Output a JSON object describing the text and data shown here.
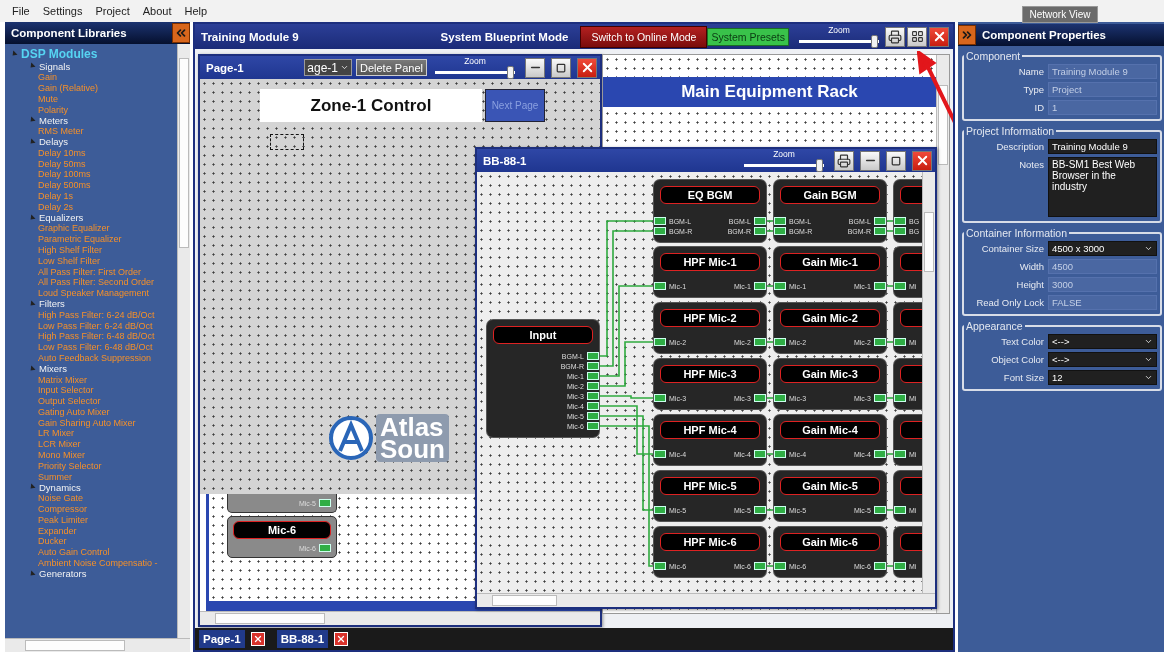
{
  "menu": [
    "File",
    "Settings",
    "Project",
    "About",
    "Help"
  ],
  "network_view_button": "Network View",
  "libraries": {
    "title": "Component Libraries",
    "tree": [
      {
        "label": "DSP Modules",
        "expanded": true,
        "children": [
          {
            "label": "Signals",
            "expanded": true,
            "children": [
              {
                "label": "Gain"
              },
              {
                "label": "Gain (Relative)"
              },
              {
                "label": "Mute"
              },
              {
                "label": "Polarity"
              }
            ]
          },
          {
            "label": "Meters",
            "expanded": true,
            "children": [
              {
                "label": "RMS Meter"
              }
            ]
          },
          {
            "label": "Delays",
            "expanded": true,
            "children": [
              {
                "label": "Delay 10ms"
              },
              {
                "label": "Delay 50ms"
              },
              {
                "label": "Delay 100ms"
              },
              {
                "label": "Delay 500ms"
              },
              {
                "label": "Delay 1s"
              },
              {
                "label": "Delay 2s"
              }
            ]
          },
          {
            "label": "Equalizers",
            "expanded": true,
            "children": [
              {
                "label": "Graphic Equalizer"
              },
              {
                "label": "Parametric Equalizer"
              },
              {
                "label": "High Shelf Filter"
              },
              {
                "label": "Low Shelf Filter"
              },
              {
                "label": "All Pass Filter: First Order"
              },
              {
                "label": "All Pass Filter: Second Order"
              },
              {
                "label": "Loud Speaker Management"
              }
            ]
          },
          {
            "label": "Filters",
            "expanded": true,
            "children": [
              {
                "label": "High Pass Filter: 6-24 dB/Oct"
              },
              {
                "label": "Low Pass Filter: 6-24 dB/Oct"
              },
              {
                "label": "High Pass Filter: 6-48 dB/Oct"
              },
              {
                "label": "Low Pass Filter: 6-48 dB/Oct"
              },
              {
                "label": "Auto Feedback Suppression"
              }
            ]
          },
          {
            "label": "Mixers",
            "expanded": true,
            "children": [
              {
                "label": "Matrix Mixer"
              },
              {
                "label": "Input Selector"
              },
              {
                "label": "Output Selector"
              },
              {
                "label": "Gating Auto Mixer"
              },
              {
                "label": "Gain Sharing Auto Mixer"
              },
              {
                "label": "LR Mixer"
              },
              {
                "label": "LCR Mixer"
              },
              {
                "label": "Mono Mixer"
              },
              {
                "label": "Priority Selector"
              },
              {
                "label": "Summer"
              }
            ]
          },
          {
            "label": "Dynamics",
            "expanded": true,
            "children": [
              {
                "label": "Noise Gate"
              },
              {
                "label": "Compressor"
              },
              {
                "label": "Peak Limiter"
              },
              {
                "label": "Expander"
              },
              {
                "label": "Ducker"
              },
              {
                "label": "Auto Gain Control"
              },
              {
                "label": "Ambient Noise Compensatio -"
              }
            ]
          },
          {
            "label": "Generators",
            "expanded": true
          }
        ]
      }
    ]
  },
  "workspace": {
    "title": "Training Module 9",
    "mode": "System Blueprint Mode",
    "online_button": "Switch to Online Mode",
    "presets_button": "System Presets",
    "zoom": {
      "label": "Zoom",
      "level": 0.95
    }
  },
  "page_window": {
    "title": "Page-1",
    "page_select": "age-1",
    "delete_button": "Delete Panel",
    "zoom": {
      "label": "Zoom",
      "level": 0.95
    },
    "zone_label": "Zone-1 Control",
    "next_button": "Next Page",
    "logo": [
      "Atlas",
      "Soun"
    ],
    "blocks": [
      {
        "outputs": [
          "Mic-5"
        ]
      },
      {
        "title": "Mic-6",
        "outputs": [
          "Mic-6"
        ]
      }
    ]
  },
  "rack_panel": {
    "title": "Main Equipment Rack"
  },
  "bb_window": {
    "title": "BB-88-1",
    "zoom": {
      "label": "Zoom",
      "level": 0.95
    },
    "input_block": {
      "title": "Input",
      "outputs": [
        "BGM-L",
        "BGM-R",
        "Mic-1",
        "Mic-2",
        "Mic-3",
        "Mic-4",
        "Mic-5",
        "Mic-6"
      ]
    },
    "columns": [
      {
        "blocks": [
          {
            "title": "EQ BGM",
            "inputs": [
              "BGM-L",
              "BGM-R"
            ],
            "outputs": [
              "BGM-L",
              "BGM-R"
            ]
          },
          {
            "title": "HPF Mic-1",
            "inputs": [
              "Mic-1"
            ],
            "outputs": [
              "Mic-1"
            ]
          },
          {
            "title": "HPF Mic-2",
            "inputs": [
              "Mic-2"
            ],
            "outputs": [
              "Mic-2"
            ]
          },
          {
            "title": "HPF Mic-3",
            "inputs": [
              "Mic-3"
            ],
            "outputs": [
              "Mic-3"
            ]
          },
          {
            "title": "HPF Mic-4",
            "inputs": [
              "Mic-4"
            ],
            "outputs": [
              "Mic-4"
            ]
          },
          {
            "title": "HPF Mic-5",
            "inputs": [
              "Mic-5"
            ],
            "outputs": [
              "Mic-5"
            ]
          },
          {
            "title": "HPF Mic-6",
            "inputs": [
              "Mic-6"
            ],
            "outputs": [
              "Mic-6"
            ]
          }
        ]
      },
      {
        "blocks": [
          {
            "title": "Gain BGM",
            "inputs": [
              "BGM-L",
              "BGM-R"
            ],
            "outputs": [
              "BGM-L",
              "BGM-R"
            ]
          },
          {
            "title": "Gain Mic-1",
            "inputs": [
              "Mic-1"
            ],
            "outputs": [
              "Mic-1"
            ]
          },
          {
            "title": "Gain Mic-2",
            "inputs": [
              "Mic-2"
            ],
            "outputs": [
              "Mic-2"
            ]
          },
          {
            "title": "Gain Mic-3",
            "inputs": [
              "Mic-3"
            ],
            "outputs": [
              "Mic-3"
            ]
          },
          {
            "title": "Gain Mic-4",
            "inputs": [
              "Mic-4"
            ],
            "outputs": [
              "Mic-4"
            ]
          },
          {
            "title": "Gain Mic-5",
            "inputs": [
              "Mic-5"
            ],
            "outputs": [
              "Mic-5"
            ]
          },
          {
            "title": "Gain Mic-6",
            "inputs": [
              "Mic-6"
            ],
            "outputs": [
              "Mic-6"
            ]
          }
        ]
      },
      {
        "blocks": [
          {
            "inputs": [
              "BG",
              "BG"
            ]
          },
          {
            "inputs": [
              "Mi"
            ]
          },
          {
            "inputs": [
              "Mi"
            ]
          },
          {
            "inputs": [
              "Mi"
            ]
          },
          {
            "inputs": [
              "Mi"
            ]
          },
          {
            "inputs": [
              "Mi"
            ]
          },
          {
            "inputs": [
              "Mi"
            ]
          }
        ]
      }
    ]
  },
  "tabs": [
    {
      "label": "Page-1"
    },
    {
      "label": "BB-88-1"
    }
  ],
  "properties": {
    "title": "Component Properties",
    "groups": [
      {
        "legend": "Component",
        "fields": [
          {
            "label": "Name",
            "value": "Training Module 9",
            "kind": "text",
            "disabled": true
          },
          {
            "label": "Type",
            "value": "Project",
            "kind": "text",
            "disabled": true
          },
          {
            "label": "ID",
            "value": "1",
            "kind": "text",
            "disabled": true
          }
        ]
      },
      {
        "legend": "Project Information",
        "fields": [
          {
            "label": "Description",
            "value": "Training Module 9",
            "kind": "text",
            "disabled": false
          },
          {
            "label": "Notes",
            "value": "BB-SM1 Best Web Browser in the industry",
            "kind": "textarea",
            "disabled": false
          }
        ]
      },
      {
        "legend": "Container Information",
        "fields": [
          {
            "label": "Container Size",
            "value": "4500 x 3000",
            "kind": "select",
            "disabled": false
          },
          {
            "label": "Width",
            "value": "4500",
            "kind": "text",
            "disabled": true
          },
          {
            "label": "Height",
            "value": "3000",
            "kind": "text",
            "disabled": true
          },
          {
            "label": "Read Only Lock",
            "value": "FALSE",
            "kind": "text",
            "disabled": true
          }
        ]
      },
      {
        "legend": "Appearance",
        "fields": [
          {
            "label": "Text Color",
            "value": "<-->",
            "kind": "select",
            "disabled": false
          },
          {
            "label": "Object Color",
            "value": "<-->",
            "kind": "select",
            "disabled": false
          },
          {
            "label": "Font Size",
            "value": "12",
            "kind": "select",
            "disabled": false
          }
        ]
      }
    ]
  }
}
